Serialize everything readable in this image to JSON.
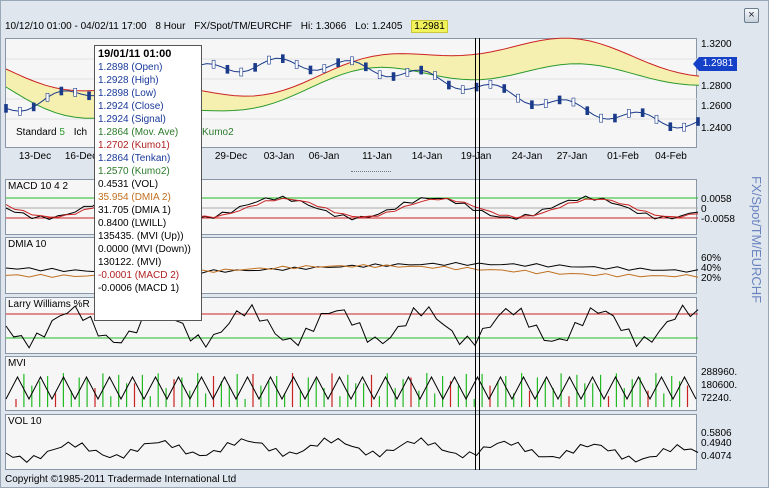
{
  "header": {
    "range": "10/12/10 01:00 - 04/02/11 17:00",
    "period": "8 Hour",
    "symbol": "FX/Spot/TM/EURCHF",
    "hi": "Hi: 1.3066",
    "lo": "Lo: 1.2405",
    "last": "1.2981"
  },
  "close_icon": "close-icon",
  "x_labels": [
    "13-Dec",
    "16-Dec",
    "29-Dec",
    "03-Jan",
    "06-Jan",
    "11-Jan",
    "14-Jan",
    "19-Jan",
    "24-Jan",
    "27-Jan",
    "01-Feb",
    "04-Feb"
  ],
  "y_labels_main": [
    "1.3200",
    "1.3000",
    "1.2800",
    "1.2600",
    "1.2400"
  ],
  "price_tag": "1.2981",
  "main_legend": {
    "standard": "Standard",
    "standard_val": "5",
    "ich": "Ich",
    "kumo2": "Kumo2"
  },
  "macd": {
    "title": "MACD 10 4 2",
    "y_labels": [
      "0.0058",
      "0",
      "-0.0058"
    ]
  },
  "dmi": {
    "title": "DMIA 10",
    "y_labels": [
      "60%",
      "40%",
      "20%"
    ]
  },
  "lw": {
    "title": "Larry Williams %R"
  },
  "mvi": {
    "title": "MVI",
    "y_labels": [
      "288960.",
      "180600.",
      "72240."
    ]
  },
  "vol": {
    "title": "VOL 10",
    "y_labels": [
      "0.5806",
      "0.4940",
      "0.4074"
    ]
  },
  "vertical_title": "FX/Spot/TM/EURCHF",
  "copyright": "Copyright ©1985-2011 Tradermade International Ltd",
  "tooltip": {
    "date": "19/01/11 01:00",
    "rows": [
      {
        "text": "1.2898 (Open)",
        "color": "#1a3a9a"
      },
      {
        "text": "1.2928 (High)",
        "color": "#1a3a9a"
      },
      {
        "text": "1.2898 (Low)",
        "color": "#1a3a9a"
      },
      {
        "text": "1.2924 (Close)",
        "color": "#1a3a9a"
      },
      {
        "text": " 1.2924 (Signal)",
        "color": "#1a3a9a"
      },
      {
        "text": "1.2864 (Mov. Ave)",
        "color": "#2a7a2a"
      },
      {
        "text": "1.2702 (Kumo1)",
        "color": "#b02020"
      },
      {
        "text": "1.2864 (Tenkan)",
        "color": "#1a3a9a"
      },
      {
        "text": "1.2570 (Kumo2)",
        "color": "#2a7a2a"
      },
      {
        "text": "0.4531 (VOL)",
        "color": "#000000"
      },
      {
        "text": "35.954 (DMIA 2)",
        "color": "#c07020"
      },
      {
        "text": "31.705 (DMIA 1)",
        "color": "#000000"
      },
      {
        "text": "0.8400 (LWILL)",
        "color": "#000000"
      },
      {
        "text": "135435. (MVI (Up))",
        "color": "#000000"
      },
      {
        "text": "0.0000 (MVI (Down))",
        "color": "#000000"
      },
      {
        "text": "130122. (MVI)",
        "color": "#000000"
      },
      {
        "text": "-0.0001 (MACD 2)",
        "color": "#b02020"
      },
      {
        "text": "-0.0006 (MACD 1)",
        "color": "#000000"
      }
    ]
  },
  "colors": {
    "cloud": "#f5f0b0",
    "kumo1": "#cc2222",
    "kumo2": "#2a9a2a",
    "signal": "#1a3a8a",
    "green": "#22bb22",
    "red": "#cc2222"
  }
}
